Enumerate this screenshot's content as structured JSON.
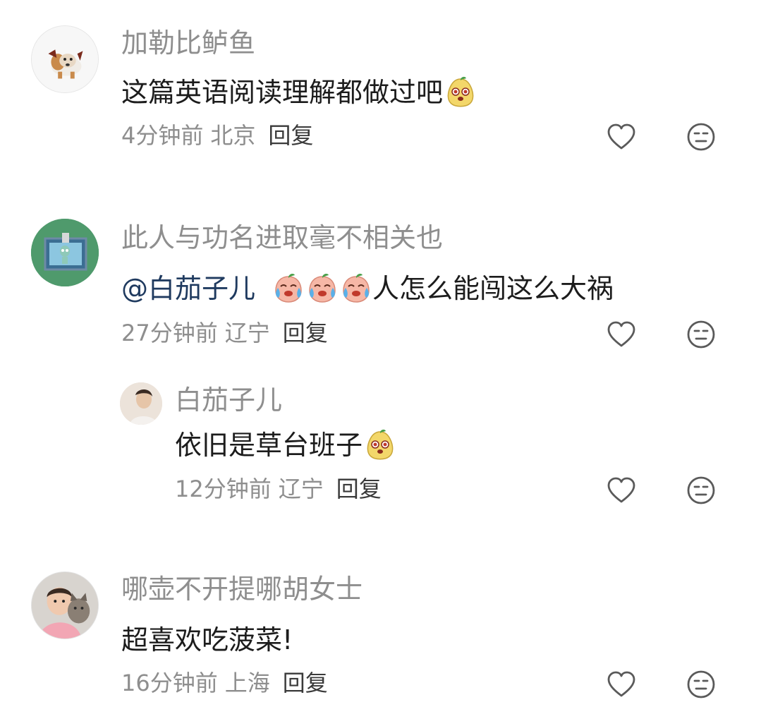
{
  "comments": [
    {
      "username": "加勒比鲈鱼",
      "text": "这篇英语阅读理解都做过吧",
      "time": "4分钟前",
      "location": "北京",
      "reply_label": "回复",
      "emoji": "yellow-pear-emoji"
    },
    {
      "username": "此人与功名进取毫不相关也",
      "mention": "@白茄子儿",
      "text": "人怎么能闯这么大祸",
      "time": "27分钟前",
      "location": "辽宁",
      "reply_label": "回复",
      "emoji": "crying-peach-emoji"
    },
    {
      "username": "白茄子儿",
      "text": "依旧是草台班子",
      "time": "12分钟前",
      "location": "辽宁",
      "reply_label": "回复",
      "emoji": "yellow-pear-emoji"
    },
    {
      "username": "哪壶不开提哪胡女士",
      "text": "超喜欢吃菠菜!",
      "time": "16分钟前",
      "location": "上海",
      "reply_label": "回复"
    }
  ],
  "icons": {
    "like": "heart-outline-icon",
    "dislike": "neutral-face-icon"
  },
  "colors": {
    "username": "#8e8e8e",
    "text": "#1c1c1c",
    "mention": "#1f3a5f",
    "meta": "#8e8e8e",
    "icon": "#5a5a5a"
  }
}
